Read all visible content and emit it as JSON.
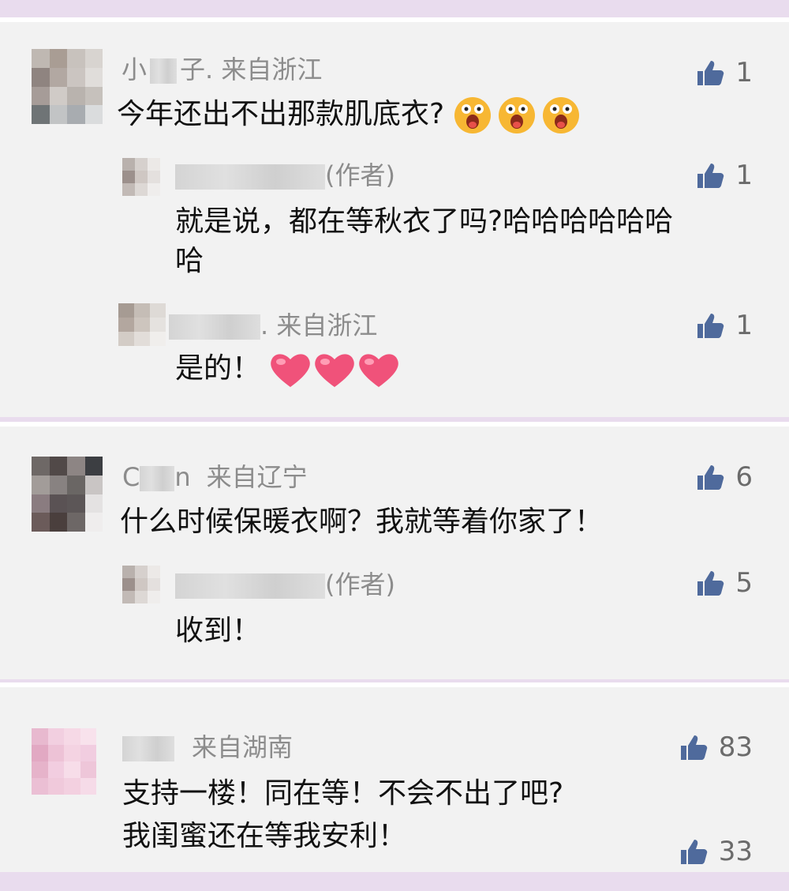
{
  "threads": [
    {
      "comment": {
        "name_prefix": "小",
        "name_suffix": "子",
        "location": ". 来自浙江",
        "text": "今年还出不出那款肌底衣?",
        "likes": "1",
        "emoji": "astonished-face"
      },
      "replies": [
        {
          "author_tag": "(作者)",
          "text_line1": "就是说，都在等秋衣了吗?哈哈哈哈哈哈",
          "text_line2": "哈",
          "likes": "1"
        },
        {
          "location": ". 来自浙江",
          "text": "是的！",
          "likes": "1",
          "emoji": "pink-heart"
        }
      ]
    },
    {
      "comment": {
        "name_prefix": "C",
        "name_suffix": "n",
        "location": "来自辽宁",
        "text": "什么时候保暖衣啊？我就等着你家了！",
        "likes": "6"
      },
      "replies": [
        {
          "author_tag": "(作者)",
          "text": "收到！",
          "likes": "5"
        }
      ]
    },
    {
      "comment": {
        "location": "来自湖南",
        "text_line1": "支持一楼！同在等！不会不出了吧?",
        "text_line2": "我闺蜜还在等我安利！",
        "likes": "83",
        "likes2": "33"
      }
    }
  ],
  "colors": {
    "like_icon": "#4f6a9c",
    "page_bg": "#e9dcee",
    "card_bg": "#f2f2f2"
  },
  "icons": {
    "like": "thumbs-up-icon"
  }
}
